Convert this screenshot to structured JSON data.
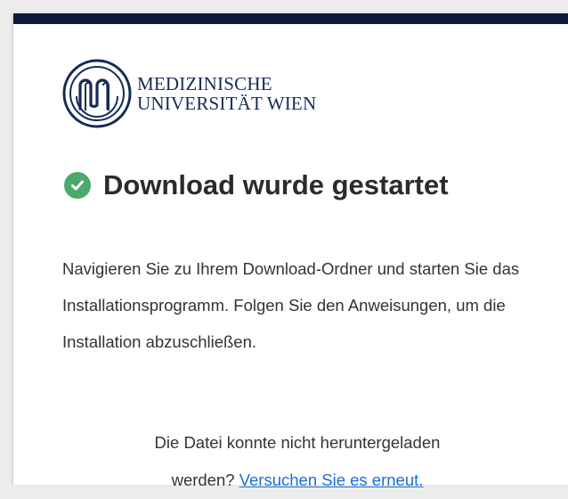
{
  "logo": {
    "line1": "MEDIZINISCHE",
    "line2": "UNIVERSITÄT WIEN"
  },
  "heading": {
    "icon": "check-circle-icon",
    "title": "Download wurde gestartet"
  },
  "instructions": "Navigieren Sie zu Ihrem Download-Ordner und starten Sie das Installationsprogramm. Folgen Sie den Anweisungen, um die Installation abzuschließen.",
  "retry": {
    "line1": "Die Datei konnte nicht heruntergeladen",
    "line2_prefix": "werden? ",
    "link": "Versuchen Sie es erneut."
  },
  "colors": {
    "topbar": "#101a3c",
    "success": "#4ba96c",
    "link": "#1a6fd6",
    "logo": "#142b55"
  }
}
